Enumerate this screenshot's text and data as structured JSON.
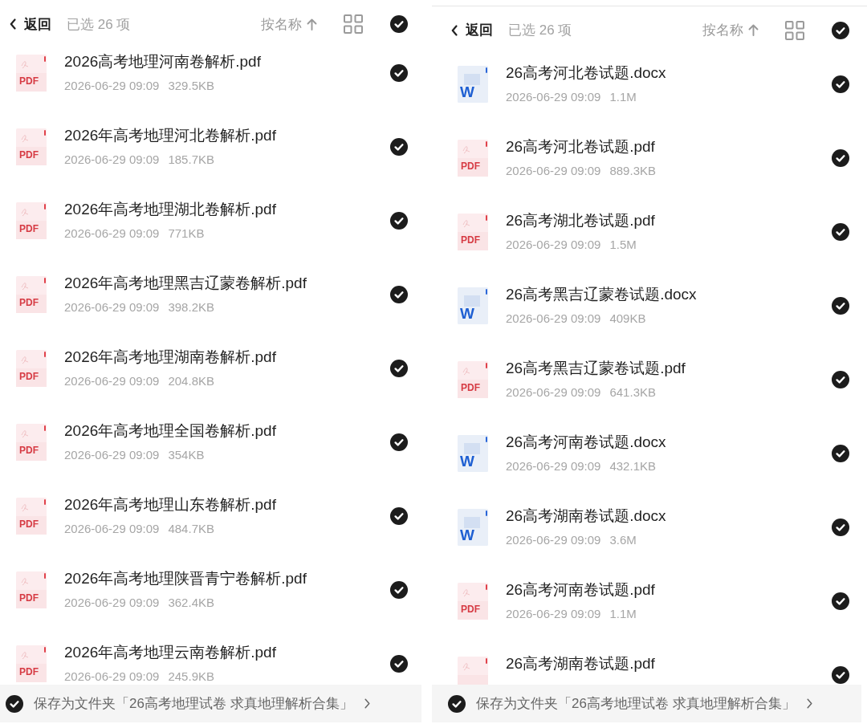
{
  "panels": [
    {
      "header": {
        "back": "返回",
        "selection_count": "已选 26 项",
        "sort": "按名称",
        "all_selected": true
      },
      "files": [
        {
          "kind": "pdf",
          "icon_text": "PDF",
          "name": "2026高考地理河南卷解析.pdf",
          "date": "2026-06-29 09:09",
          "size": "329.5KB",
          "selected": true
        },
        {
          "kind": "pdf",
          "icon_text": "PDF",
          "name": "2026年高考地理河北卷解析.pdf",
          "date": "2026-06-29 09:09",
          "size": "185.7KB",
          "selected": true
        },
        {
          "kind": "pdf",
          "icon_text": "PDF",
          "name": "2026年高考地理湖北卷解析.pdf",
          "date": "2026-06-29 09:09",
          "size": "771KB",
          "selected": true
        },
        {
          "kind": "pdf",
          "icon_text": "PDF",
          "name": "2026年高考地理黑吉辽蒙卷解析.pdf",
          "date": "2026-06-29 09:09",
          "size": "398.2KB",
          "selected": true
        },
        {
          "kind": "pdf",
          "icon_text": "PDF",
          "name": "2026年高考地理湖南卷解析.pdf",
          "date": "2026-06-29 09:09",
          "size": "204.8KB",
          "selected": true
        },
        {
          "kind": "pdf",
          "icon_text": "PDF",
          "name": "2026年高考地理全国卷解析.pdf",
          "date": "2026-06-29 09:09",
          "size": "354KB",
          "selected": true
        },
        {
          "kind": "pdf",
          "icon_text": "PDF",
          "name": "2026年高考地理山东卷解析.pdf",
          "date": "2026-06-29 09:09",
          "size": "484.7KB",
          "selected": true
        },
        {
          "kind": "pdf",
          "icon_text": "PDF",
          "name": "2026年高考地理陕晋青宁卷解析.pdf",
          "date": "2026-06-29 09:09",
          "size": "362.4KB",
          "selected": true
        },
        {
          "kind": "pdf",
          "icon_text": "PDF",
          "name": "2026年高考地理云南卷解析.pdf",
          "date": "2026-06-29 09:09",
          "size": "245.9KB",
          "selected": true
        }
      ],
      "save_option": {
        "text": "保存为文件夹「26高考地理试卷 求真地理解析合集」",
        "checked": true
      }
    },
    {
      "header": {
        "back": "返回",
        "selection_count": "已选 26 项",
        "sort": "按名称",
        "all_selected": true
      },
      "files": [
        {
          "kind": "docx",
          "icon_text": "W",
          "name": "26高考河北卷试题.docx",
          "date": "2026-06-29 09:09",
          "size": "1.1M",
          "selected": true
        },
        {
          "kind": "pdf",
          "icon_text": "PDF",
          "name": "26高考河北卷试题.pdf",
          "date": "2026-06-29 09:09",
          "size": "889.3KB",
          "selected": true
        },
        {
          "kind": "pdf",
          "icon_text": "PDF",
          "name": "26高考湖北卷试题.pdf",
          "date": "2026-06-29 09:09",
          "size": "1.5M",
          "selected": true
        },
        {
          "kind": "docx",
          "icon_text": "W",
          "name": "26高考黑吉辽蒙卷试题.docx",
          "date": "2026-06-29 09:09",
          "size": "409KB",
          "selected": true
        },
        {
          "kind": "pdf",
          "icon_text": "PDF",
          "name": "26高考黑吉辽蒙卷试题.pdf",
          "date": "2026-06-29 09:09",
          "size": "641.3KB",
          "selected": true
        },
        {
          "kind": "docx",
          "icon_text": "W",
          "name": "26高考河南卷试题.docx",
          "date": "2026-06-29 09:09",
          "size": "432.1KB",
          "selected": true
        },
        {
          "kind": "docx",
          "icon_text": "W",
          "name": "26高考湖南卷试题.docx",
          "date": "2026-06-29 09:09",
          "size": "3.6M",
          "selected": true
        },
        {
          "kind": "pdf",
          "icon_text": "PDF",
          "name": "26高考河南卷试题.pdf",
          "date": "2026-06-29 09:09",
          "size": "1.1M",
          "selected": true
        },
        {
          "kind": "pdf",
          "name": "26高考湖南卷试题.pdf",
          "selected": true
        }
      ],
      "save_option": {
        "text": "保存为文件夹「26高考地理试卷 求真地理解析合集」",
        "checked": true
      }
    }
  ]
}
